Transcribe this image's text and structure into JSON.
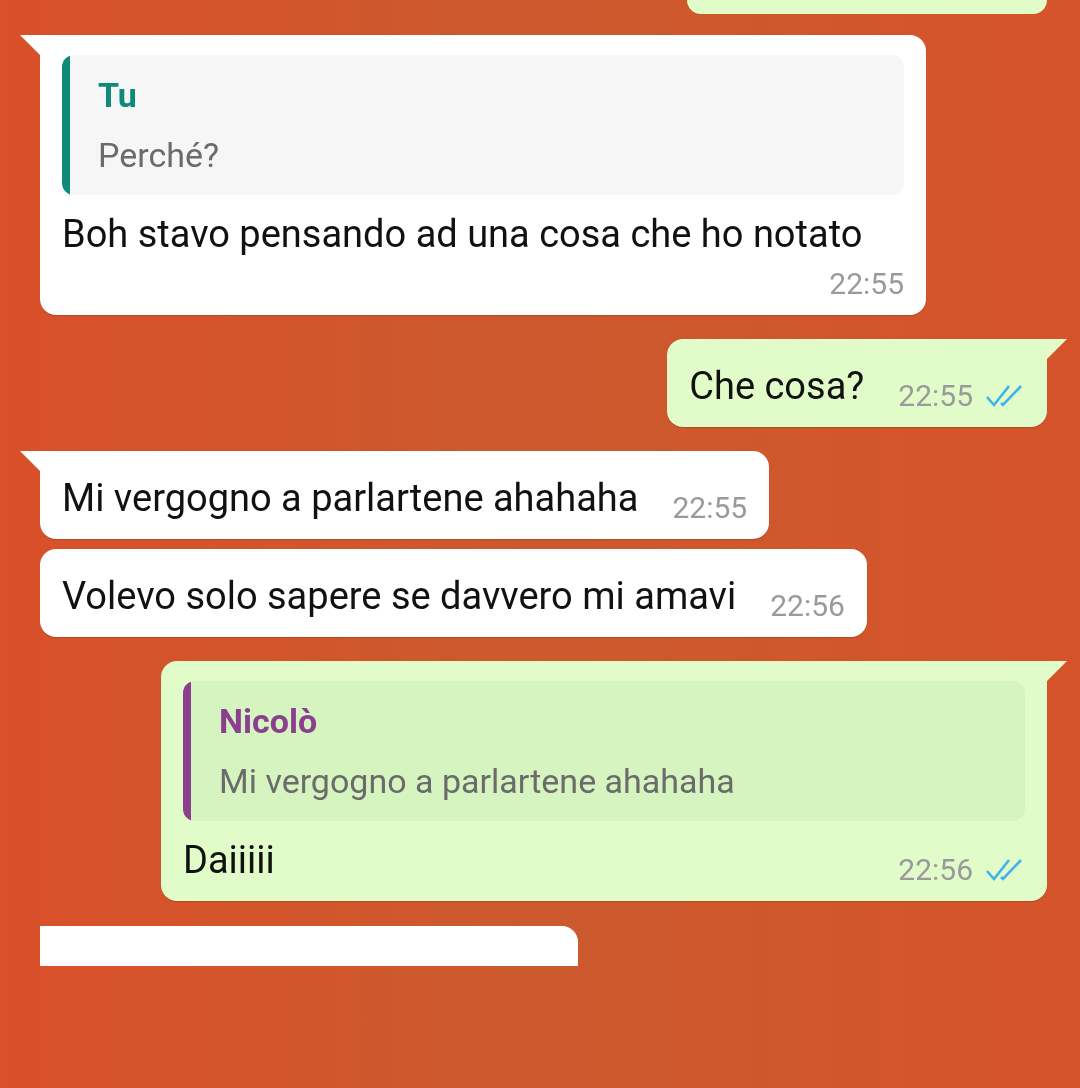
{
  "messages": [
    {
      "kind": "in",
      "tail": true,
      "quote": {
        "author": "Tu",
        "text": "Perché?",
        "color": "#0e8a7a"
      },
      "text": "Boh stavo pensando ad una cosa che ho notato",
      "time": "22:55"
    },
    {
      "kind": "out",
      "tail": true,
      "text": "Che cosa?",
      "time": "22:55",
      "read": true
    },
    {
      "kind": "in",
      "tail": true,
      "text": "Mi vergogno a parlartene ahahaha",
      "time": "22:55"
    },
    {
      "kind": "in",
      "tail": false,
      "text": "Volevo solo sapere se davvero mi amavi",
      "time": "22:56"
    },
    {
      "kind": "out",
      "tail": true,
      "quote": {
        "author": "Nicolò",
        "text": "Mi vergogno a parlartene ahahaha",
        "color": "#8b3f8f"
      },
      "text": "Daiiiii",
      "time": "22:56",
      "read": true
    }
  ]
}
